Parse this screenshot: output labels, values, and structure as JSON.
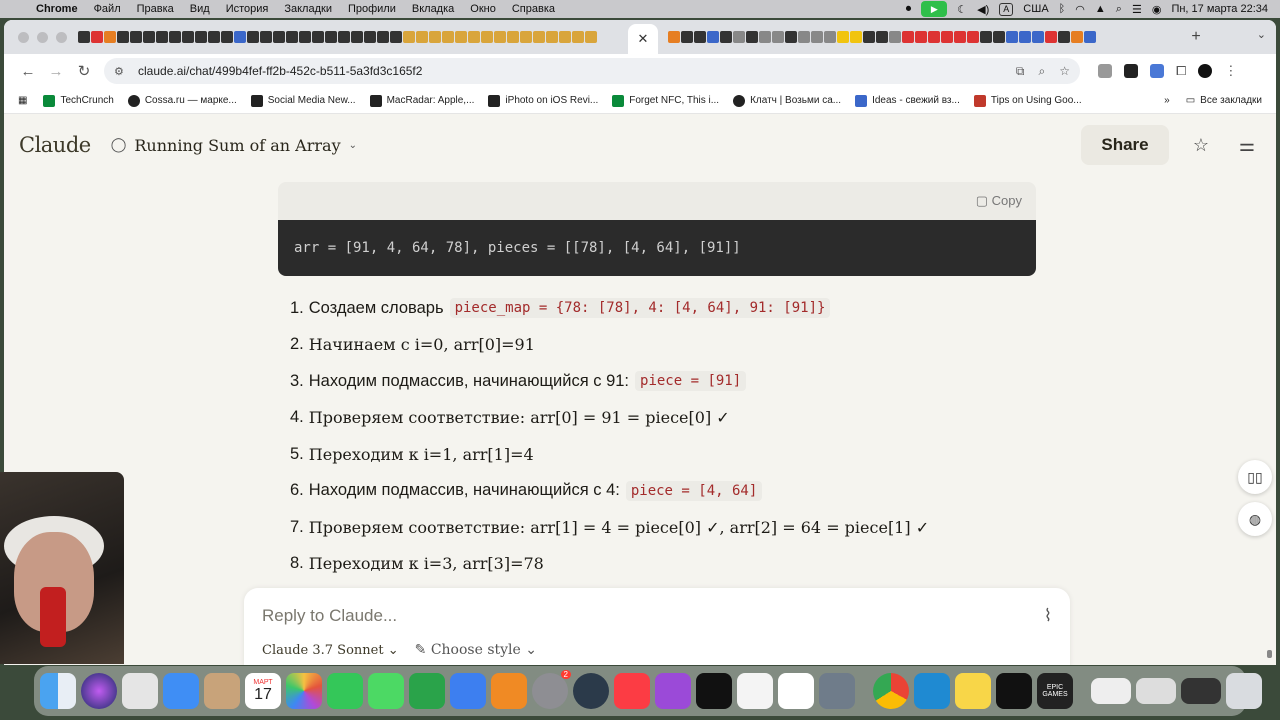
{
  "menubar": {
    "app_name": "Chrome",
    "items": [
      "Файл",
      "Правка",
      "Вид",
      "История",
      "Закладки",
      "Профили",
      "Вкладка",
      "Окно",
      "Справка"
    ],
    "input_source": "А",
    "region": "США",
    "datetime": "Пн, 17 марта  22:34"
  },
  "browser": {
    "url": "claude.ai/chat/499b4fef-ff2b-452c-b511-5a3fd3c165f2",
    "bookmarks": [
      "TechCrunch",
      "Cossa.ru — марке...",
      "Social Media New...",
      "MacRadar: Apple,...",
      "iPhoto on iOS Revi...",
      "Forget NFC, This i...",
      "Клатч | Возьми са...",
      "Ideas - свежий вз...",
      "Tips on Using Goo..."
    ],
    "bookmarks_more": "»",
    "all_bookmarks": "Все закладки"
  },
  "claude": {
    "logo": "Claude",
    "chat_title": "Running Sum of an Array",
    "share_label": "Share",
    "code_block": {
      "copy_label": "Copy",
      "code": "arr = [91, 4, 64, 78], pieces = [[78], [4, 64], [91]]"
    },
    "steps": [
      {
        "num": "1.",
        "text": "Создаем словарь",
        "code": "piece_map = {78: [78], 4: [4, 64], 91: [91]}"
      },
      {
        "num": "2.",
        "text": "Начинаем с i=0, arr[0]=91"
      },
      {
        "num": "3.",
        "text": "Находим подмассив, начинающийся с 91:",
        "code": "piece = [91]"
      },
      {
        "num": "4.",
        "text": "Проверяем соответствие: arr[0] = 91 = piece[0] ✓"
      },
      {
        "num": "5.",
        "text": "Переходим к i=1, arr[1]=4"
      },
      {
        "num": "6.",
        "text": "Находим подмассив, начинающийся с 4:",
        "code": "piece = [4, 64]"
      },
      {
        "num": "7.",
        "text": "Проверяем соответствие: arr[1] = 4 = piece[0] ✓, arr[2] = 64 = piece[1] ✓"
      },
      {
        "num": "8.",
        "text": "Переходим к i=3, arr[3]=78"
      }
    ],
    "composer": {
      "placeholder": "Reply to Claude...",
      "model": "Claude 3.7 Sonnet",
      "style": "Choose style"
    }
  },
  "dock": {
    "calendar_month": "МАРТ",
    "calendar_day": "17",
    "settings_badge": "2",
    "epic_label": "EPIC GAMES"
  }
}
